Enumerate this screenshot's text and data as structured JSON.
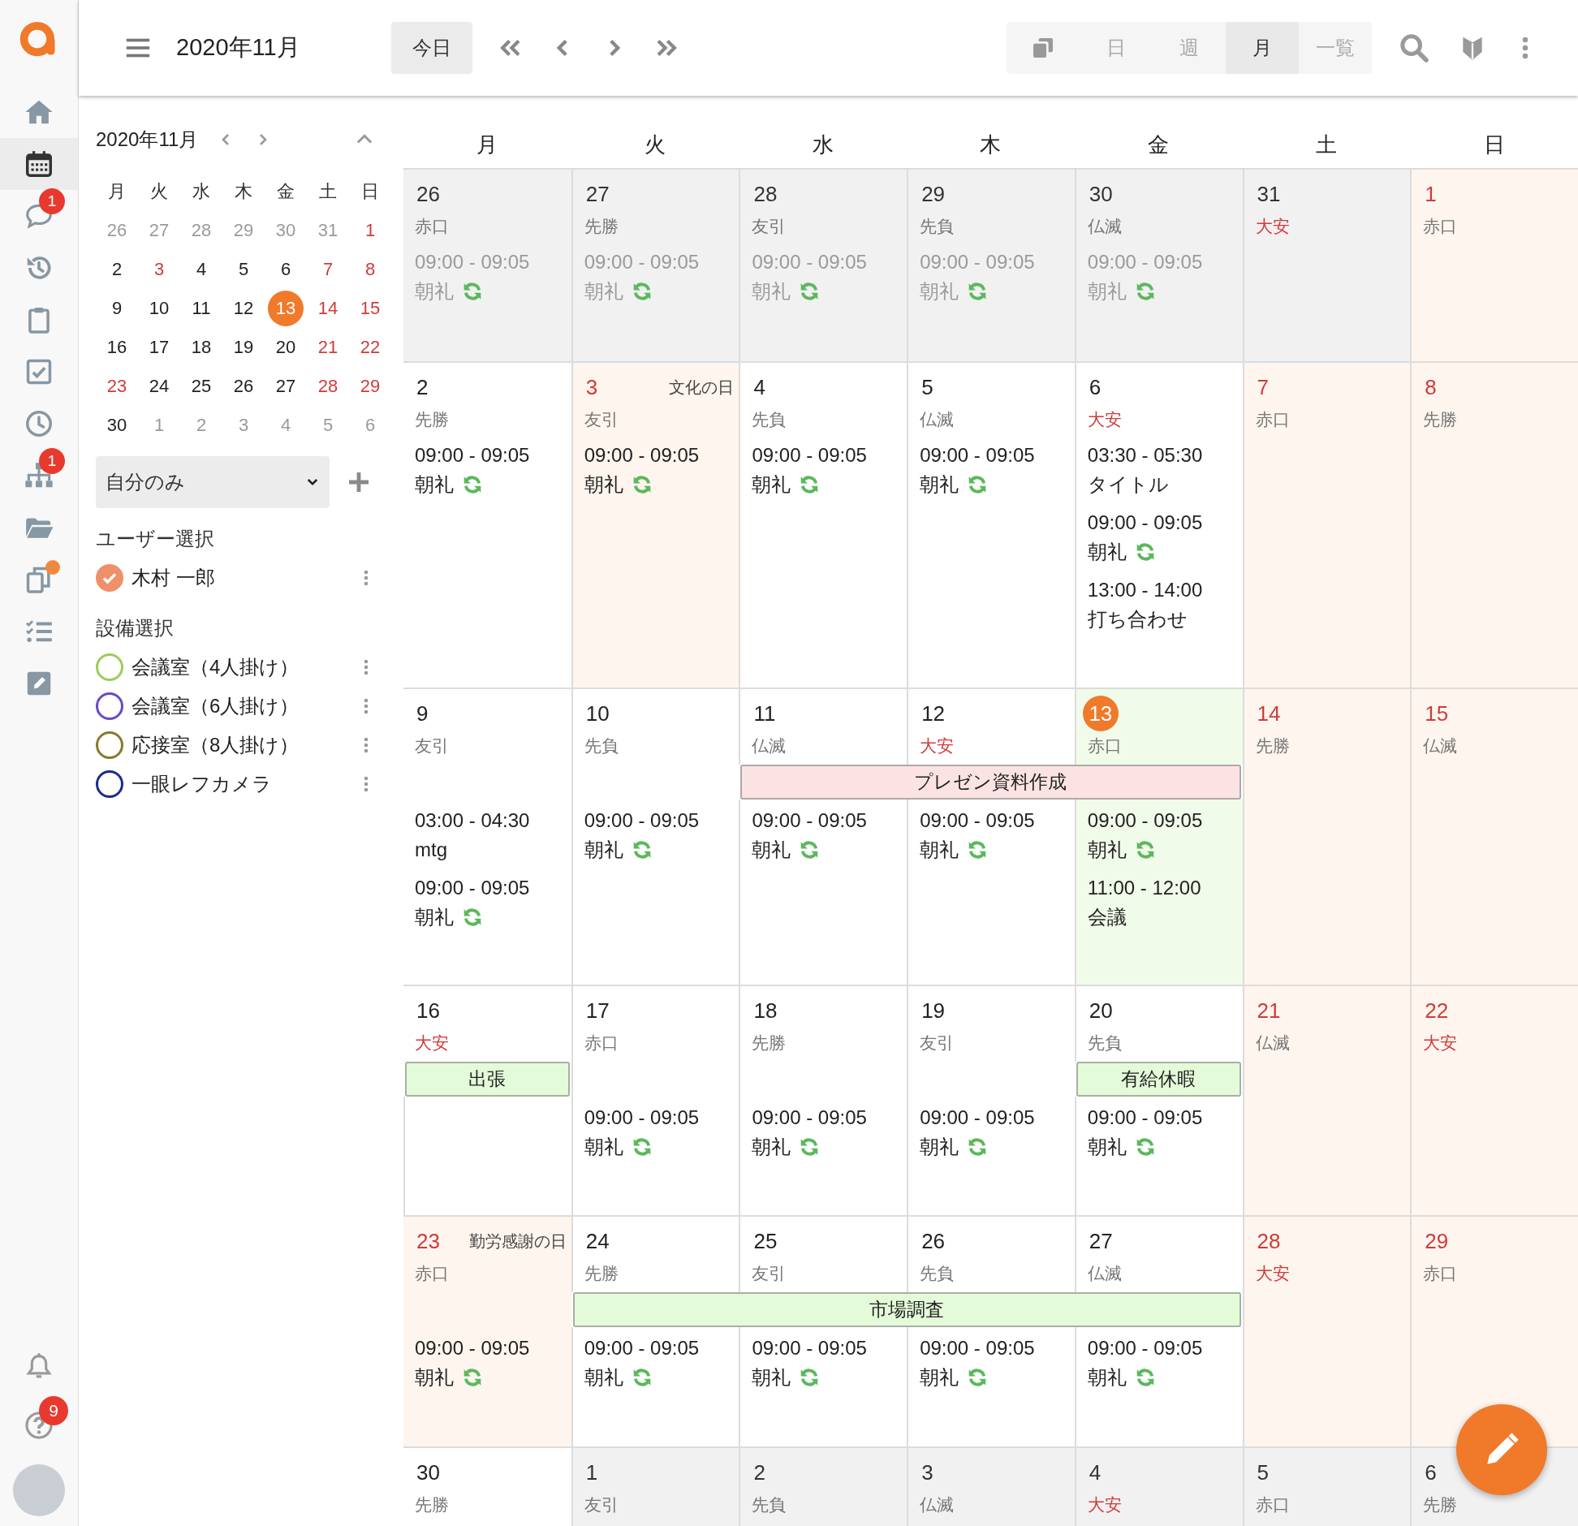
{
  "rail": {
    "items": [
      {
        "selected": false,
        "dot": false
      },
      {
        "selected": true,
        "dot": false
      },
      {
        "selected": false,
        "badge": "1",
        "dot": false
      },
      {
        "selected": false,
        "dot": false
      },
      {
        "selected": false,
        "dot": false
      },
      {
        "selected": false,
        "dot": false
      },
      {
        "selected": false,
        "dot": false
      },
      {
        "selected": false,
        "badge": "1",
        "dot": false
      },
      {
        "selected": false,
        "dot": false
      },
      {
        "selected": false,
        "dot": true
      },
      {
        "selected": false,
        "dot": false
      },
      {
        "selected": false,
        "dot": false
      }
    ],
    "bottom_items": [
      {
        "selected": false
      },
      {
        "selected": false,
        "badge": "9"
      }
    ]
  },
  "toolbar": {
    "title": "2020年11月",
    "today_button": "今日",
    "views": [
      {
        "kind": "icon",
        "selected": false
      },
      {
        "kind": "text",
        "label": "日",
        "selected": false
      },
      {
        "kind": "text",
        "label": "週",
        "selected": false
      },
      {
        "kind": "text",
        "label": "月",
        "selected": true
      },
      {
        "kind": "text",
        "label": "一覧",
        "selected": false
      }
    ]
  },
  "mini_calendar": {
    "title": "2020年11月",
    "weekdays": [
      "月",
      "火",
      "水",
      "木",
      "金",
      "土",
      "日"
    ],
    "weeks": [
      [
        {
          "d": "26",
          "in_month": false,
          "red": false,
          "today": false
        },
        {
          "d": "27",
          "in_month": false,
          "red": false,
          "today": false
        },
        {
          "d": "28",
          "in_month": false,
          "red": false,
          "today": false
        },
        {
          "d": "29",
          "in_month": false,
          "red": false,
          "today": false
        },
        {
          "d": "30",
          "in_month": false,
          "red": false,
          "today": false
        },
        {
          "d": "31",
          "in_month": false,
          "red": false,
          "today": false
        },
        {
          "d": "1",
          "in_month": true,
          "red": true,
          "today": false
        }
      ],
      [
        {
          "d": "2",
          "in_month": true,
          "red": false,
          "today": false
        },
        {
          "d": "3",
          "in_month": true,
          "red": true,
          "today": false
        },
        {
          "d": "4",
          "in_month": true,
          "red": false,
          "today": false
        },
        {
          "d": "5",
          "in_month": true,
          "red": false,
          "today": false
        },
        {
          "d": "6",
          "in_month": true,
          "red": false,
          "today": false
        },
        {
          "d": "7",
          "in_month": true,
          "red": true,
          "today": false
        },
        {
          "d": "8",
          "in_month": true,
          "red": true,
          "today": false
        }
      ],
      [
        {
          "d": "9",
          "in_month": true,
          "red": false,
          "today": false
        },
        {
          "d": "10",
          "in_month": true,
          "red": false,
          "today": false
        },
        {
          "d": "11",
          "in_month": true,
          "red": false,
          "today": false
        },
        {
          "d": "12",
          "in_month": true,
          "red": false,
          "today": false
        },
        {
          "d": "13",
          "in_month": true,
          "red": false,
          "today": true
        },
        {
          "d": "14",
          "in_month": true,
          "red": true,
          "today": false
        },
        {
          "d": "15",
          "in_month": true,
          "red": true,
          "today": false
        }
      ],
      [
        {
          "d": "16",
          "in_month": true,
          "red": false,
          "today": false
        },
        {
          "d": "17",
          "in_month": true,
          "red": false,
          "today": false
        },
        {
          "d": "18",
          "in_month": true,
          "red": false,
          "today": false
        },
        {
          "d": "19",
          "in_month": true,
          "red": false,
          "today": false
        },
        {
          "d": "20",
          "in_month": true,
          "red": false,
          "today": false
        },
        {
          "d": "21",
          "in_month": true,
          "red": true,
          "today": false
        },
        {
          "d": "22",
          "in_month": true,
          "red": true,
          "today": false
        }
      ],
      [
        {
          "d": "23",
          "in_month": true,
          "red": true,
          "today": false
        },
        {
          "d": "24",
          "in_month": true,
          "red": false,
          "today": false
        },
        {
          "d": "25",
          "in_month": true,
          "red": false,
          "today": false
        },
        {
          "d": "26",
          "in_month": true,
          "red": false,
          "today": false
        },
        {
          "d": "27",
          "in_month": true,
          "red": false,
          "today": false
        },
        {
          "d": "28",
          "in_month": true,
          "red": true,
          "today": false
        },
        {
          "d": "29",
          "in_month": true,
          "red": true,
          "today": false
        }
      ],
      [
        {
          "d": "30",
          "in_month": true,
          "red": false,
          "today": false
        },
        {
          "d": "1",
          "in_month": false,
          "red": false,
          "today": false
        },
        {
          "d": "2",
          "in_month": false,
          "red": false,
          "today": false
        },
        {
          "d": "3",
          "in_month": false,
          "red": false,
          "today": false
        },
        {
          "d": "4",
          "in_month": false,
          "red": false,
          "today": false
        },
        {
          "d": "5",
          "in_month": false,
          "red": false,
          "today": false
        },
        {
          "d": "6",
          "in_month": false,
          "red": false,
          "today": false
        }
      ]
    ]
  },
  "filter": {
    "value": "自分のみ"
  },
  "user_section": {
    "heading": "ユーザー選択",
    "items": [
      {
        "name": "木村 一郎",
        "color": "#f0906a",
        "checked": true
      }
    ]
  },
  "facility_section": {
    "heading": "設備選択",
    "items": [
      {
        "name": "会議室（4人掛け）",
        "color": "#9acd5a",
        "checked": false
      },
      {
        "name": "会議室（6人掛け）",
        "color": "#6a48c8",
        "checked": false
      },
      {
        "name": "応接室（8人掛け）",
        "color": "#857a2a",
        "checked": false
      },
      {
        "name": "一眼レフカメラ",
        "color": "#1c2a8a",
        "checked": false
      }
    ]
  },
  "calendar": {
    "weekdays": [
      "月",
      "火",
      "水",
      "木",
      "金",
      "土",
      "日"
    ],
    "weeks": [
      {
        "days": [
          {
            "date": "26",
            "rokuyo": "赤口",
            "in_month": false,
            "day_off": false,
            "today": false,
            "red_rokuyo": false,
            "events": [
              {
                "time": "09:00 - 09:05",
                "title": "朝礼",
                "recurring": true
              }
            ]
          },
          {
            "date": "27",
            "rokuyo": "先勝",
            "in_month": false,
            "day_off": false,
            "today": false,
            "red_rokuyo": false,
            "events": [
              {
                "time": "09:00 - 09:05",
                "title": "朝礼",
                "recurring": true
              }
            ]
          },
          {
            "date": "28",
            "rokuyo": "友引",
            "in_month": false,
            "day_off": false,
            "today": false,
            "red_rokuyo": false,
            "events": [
              {
                "time": "09:00 - 09:05",
                "title": "朝礼",
                "recurring": true
              }
            ]
          },
          {
            "date": "29",
            "rokuyo": "先負",
            "in_month": false,
            "day_off": false,
            "today": false,
            "red_rokuyo": false,
            "events": [
              {
                "time": "09:00 - 09:05",
                "title": "朝礼",
                "recurring": true
              }
            ]
          },
          {
            "date": "30",
            "rokuyo": "仏滅",
            "in_month": false,
            "day_off": false,
            "today": false,
            "red_rokuyo": false,
            "events": [
              {
                "time": "09:00 - 09:05",
                "title": "朝礼",
                "recurring": true
              }
            ]
          },
          {
            "date": "31",
            "rokuyo": "大安",
            "in_month": false,
            "day_off": false,
            "today": false,
            "red_rokuyo": true
          },
          {
            "date": "1",
            "rokuyo": "赤口",
            "in_month": true,
            "day_off": true,
            "today": false,
            "red_rokuyo": false
          }
        ]
      },
      {
        "days": [
          {
            "date": "2",
            "rokuyo": "先勝",
            "in_month": true,
            "day_off": false,
            "today": false,
            "red_rokuyo": false,
            "events": [
              {
                "time": "09:00 - 09:05",
                "title": "朝礼",
                "recurring": true
              }
            ]
          },
          {
            "date": "3",
            "holiday": "文化の日",
            "rokuyo": "友引",
            "in_month": true,
            "day_off": true,
            "today": false,
            "red_rokuyo": false,
            "events": [
              {
                "time": "09:00 - 09:05",
                "title": "朝礼",
                "recurring": true
              }
            ]
          },
          {
            "date": "4",
            "rokuyo": "先負",
            "in_month": true,
            "day_off": false,
            "today": false,
            "red_rokuyo": false,
            "events": [
              {
                "time": "09:00 - 09:05",
                "title": "朝礼",
                "recurring": true
              }
            ]
          },
          {
            "date": "5",
            "rokuyo": "仏滅",
            "in_month": true,
            "day_off": false,
            "today": false,
            "red_rokuyo": false,
            "events": [
              {
                "time": "09:00 - 09:05",
                "title": "朝礼",
                "recurring": true
              }
            ]
          },
          {
            "date": "6",
            "rokuyo": "大安",
            "in_month": true,
            "day_off": false,
            "today": false,
            "red_rokuyo": true,
            "events": [
              {
                "time": "03:30 - 05:30",
                "title": "タイトル",
                "recurring": false
              },
              {
                "time": "09:00 - 09:05",
                "title": "朝礼",
                "recurring": true
              },
              {
                "time": "13:00 - 14:00",
                "title": "打ち合わせ",
                "recurring": false
              }
            ]
          },
          {
            "date": "7",
            "rokuyo": "赤口",
            "in_month": true,
            "day_off": true,
            "today": false,
            "red_rokuyo": false
          },
          {
            "date": "8",
            "rokuyo": "先勝",
            "in_month": true,
            "day_off": true,
            "today": false,
            "red_rokuyo": false
          }
        ]
      },
      {
        "days": [
          {
            "date": "9",
            "rokuyo": "友引",
            "in_month": true,
            "day_off": false,
            "today": false,
            "red_rokuyo": false,
            "events": [
              {
                "time": "03:00 - 04:30",
                "title": "mtg",
                "recurring": false
              },
              {
                "time": "09:00 - 09:05",
                "title": "朝礼",
                "recurring": true
              }
            ]
          },
          {
            "date": "10",
            "rokuyo": "先負",
            "in_month": true,
            "day_off": false,
            "today": false,
            "red_rokuyo": false,
            "events": [
              {
                "time": "09:00 - 09:05",
                "title": "朝礼",
                "recurring": true
              }
            ]
          },
          {
            "date": "11",
            "rokuyo": "仏滅",
            "in_month": true,
            "day_off": false,
            "today": false,
            "red_rokuyo": false,
            "bar": {
              "title": "プレゼン資料作成",
              "color": "#fbe3e3"
            },
            "events": [
              {
                "time": "09:00 - 09:05",
                "title": "朝礼",
                "recurring": true
              }
            ]
          },
          {
            "date": "12",
            "rokuyo": "大安",
            "in_month": true,
            "day_off": false,
            "today": false,
            "red_rokuyo": true,
            "bar_continued": true,
            "events": [
              {
                "time": "09:00 - 09:05",
                "title": "朝礼",
                "recurring": true
              }
            ]
          },
          {
            "date": "13",
            "rokuyo": "赤口",
            "in_month": true,
            "day_off": false,
            "today": true,
            "red_rokuyo": false,
            "bar_continued": true,
            "events": [
              {
                "time": "09:00 - 09:05",
                "title": "朝礼",
                "recurring": true
              },
              {
                "time": "11:00 - 12:00",
                "title": "会議",
                "recurring": false
              }
            ]
          },
          {
            "date": "14",
            "rokuyo": "先勝",
            "in_month": true,
            "day_off": true,
            "today": false,
            "red_rokuyo": false
          },
          {
            "date": "15",
            "rokuyo": "仏滅",
            "in_month": true,
            "day_off": true,
            "today": false,
            "red_rokuyo": false
          }
        ]
      },
      {
        "days": [
          {
            "date": "16",
            "rokuyo": "大安",
            "in_month": true,
            "day_off": false,
            "today": false,
            "red_rokuyo": true,
            "bar": {
              "title": "出張",
              "color": "#e3fbd9"
            }
          },
          {
            "date": "17",
            "rokuyo": "赤口",
            "in_month": true,
            "day_off": false,
            "today": false,
            "red_rokuyo": false,
            "events": [
              {
                "time": "09:00 - 09:05",
                "title": "朝礼",
                "recurring": true
              }
            ]
          },
          {
            "date": "18",
            "rokuyo": "先勝",
            "in_month": true,
            "day_off": false,
            "today": false,
            "red_rokuyo": false,
            "events": [
              {
                "time": "09:00 - 09:05",
                "title": "朝礼",
                "recurring": true
              }
            ]
          },
          {
            "date": "19",
            "rokuyo": "友引",
            "in_month": true,
            "day_off": false,
            "today": false,
            "red_rokuyo": false,
            "events": [
              {
                "time": "09:00 - 09:05",
                "title": "朝礼",
                "recurring": true
              }
            ]
          },
          {
            "date": "20",
            "rokuyo": "先負",
            "in_month": true,
            "day_off": false,
            "today": false,
            "red_rokuyo": false,
            "bar": {
              "title": "有給休暇",
              "color": "#e3fbd9"
            },
            "events": [
              {
                "time": "09:00 - 09:05",
                "title": "朝礼",
                "recurring": true
              }
            ]
          },
          {
            "date": "21",
            "rokuyo": "仏滅",
            "in_month": true,
            "day_off": true,
            "today": false,
            "red_rokuyo": false
          },
          {
            "date": "22",
            "rokuyo": "大安",
            "in_month": true,
            "day_off": true,
            "today": false,
            "red_rokuyo": true
          }
        ]
      },
      {
        "days": [
          {
            "date": "23",
            "holiday": "勤労感謝の日",
            "rokuyo": "赤口",
            "in_month": true,
            "day_off": true,
            "today": false,
            "red_rokuyo": false,
            "events": [
              {
                "time": "09:00 - 09:05",
                "title": "朝礼",
                "recurring": true
              }
            ]
          },
          {
            "date": "24",
            "rokuyo": "先勝",
            "in_month": true,
            "day_off": false,
            "today": false,
            "red_rokuyo": false,
            "bar": {
              "title": "市場調査",
              "color": "#e3fbd9"
            },
            "events": [
              {
                "time": "09:00 - 09:05",
                "title": "朝礼",
                "recurring": true
              }
            ]
          },
          {
            "date": "25",
            "rokuyo": "友引",
            "in_month": true,
            "day_off": false,
            "today": false,
            "red_rokuyo": false,
            "bar_continued": true,
            "events": [
              {
                "time": "09:00 - 09:05",
                "title": "朝礼",
                "recurring": true
              }
            ]
          },
          {
            "date": "26",
            "rokuyo": "先負",
            "in_month": true,
            "day_off": false,
            "today": false,
            "red_rokuyo": false,
            "bar_continued": true,
            "events": [
              {
                "time": "09:00 - 09:05",
                "title": "朝礼",
                "recurring": true
              }
            ]
          },
          {
            "date": "27",
            "rokuyo": "仏滅",
            "in_month": true,
            "day_off": false,
            "today": false,
            "red_rokuyo": false,
            "bar_continued": true,
            "events": [
              {
                "time": "09:00 - 09:05",
                "title": "朝礼",
                "recurring": true
              }
            ]
          },
          {
            "date": "28",
            "rokuyo": "大安",
            "in_month": true,
            "day_off": true,
            "today": false,
            "red_rokuyo": true
          },
          {
            "date": "29",
            "rokuyo": "赤口",
            "in_month": true,
            "day_off": true,
            "today": false,
            "red_rokuyo": false
          }
        ]
      },
      {
        "days": [
          {
            "date": "30",
            "rokuyo": "先勝",
            "in_month": true,
            "day_off": false,
            "today": false,
            "red_rokuyo": false
          },
          {
            "date": "1",
            "rokuyo": "友引",
            "in_month": false,
            "day_off": false,
            "today": false,
            "red_rokuyo": false
          },
          {
            "date": "2",
            "rokuyo": "先負",
            "in_month": false,
            "day_off": false,
            "today": false,
            "red_rokuyo": false
          },
          {
            "date": "3",
            "rokuyo": "仏滅",
            "in_month": false,
            "day_off": false,
            "today": false,
            "red_rokuyo": false
          },
          {
            "date": "4",
            "rokuyo": "大安",
            "in_month": false,
            "day_off": false,
            "today": false,
            "red_rokuyo": true
          },
          {
            "date": "5",
            "rokuyo": "赤口",
            "in_month": false,
            "day_off": false,
            "today": false,
            "red_rokuyo": false
          },
          {
            "date": "6",
            "rokuyo": "先勝",
            "in_month": false,
            "day_off": false,
            "today": false,
            "red_rokuyo": false
          }
        ]
      }
    ]
  }
}
